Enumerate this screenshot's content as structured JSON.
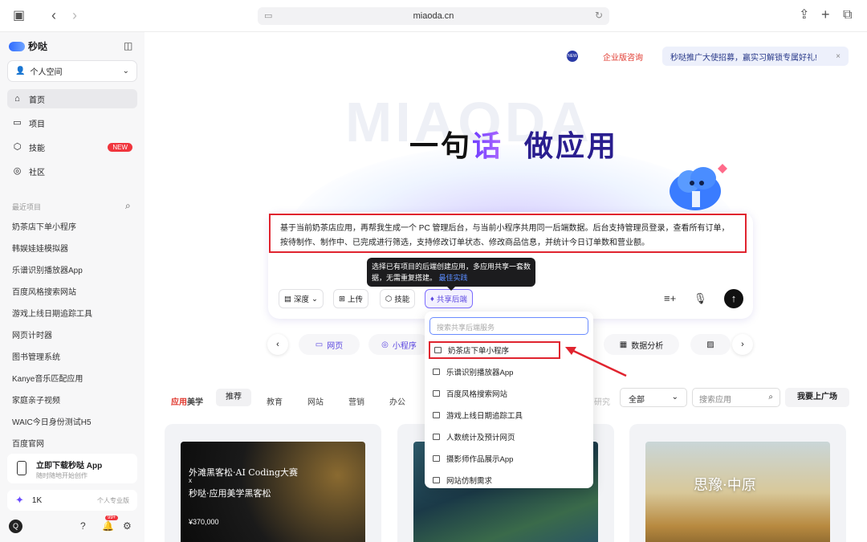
{
  "browser": {
    "url": "miaoda.cn"
  },
  "sidebar": {
    "brand": "秒哒",
    "workspace": "个人空间",
    "nav": [
      {
        "label": "首页",
        "icon": "home-icon"
      },
      {
        "label": "项目",
        "icon": "folder-icon"
      },
      {
        "label": "技能",
        "icon": "skill-icon",
        "badge": "NEW"
      },
      {
        "label": "社区",
        "icon": "community-icon"
      }
    ],
    "recent_title": "最近项目",
    "recent": [
      "奶茶店下单小程序",
      "韩娱娃娃模拟器",
      "乐谱识别播放器App",
      "百度风格搜索网站",
      "游戏上线日期追踪工具",
      "网页计时器",
      "图书管理系统",
      "Kanye音乐匹配应用",
      "家庭亲子视频",
      "WAIC今日身份测试H5",
      "百度官网"
    ],
    "download": {
      "title": "立即下载秒哒 App",
      "subtitle": "随时随地开始创作"
    },
    "pro": {
      "count": "1K",
      "label": "个人专业版"
    },
    "avatar": "Q",
    "notif_badge": "99+"
  },
  "header": {
    "new_badge": "NEW",
    "enterprise": "企业版咨询",
    "promo": "秒哒推广大使招募，赢实习解锁专属好礼!"
  },
  "hero": {
    "watermark": "MIAODA",
    "part1": "一句",
    "part2": "话",
    "part3": "做应用"
  },
  "prompt": {
    "text": "基于当前奶茶店应用，再帮我生成一个 PC 管理后台，与当前小程序共用同一后端数据。后台支持管理员登录，查看所有订单，按待制作、制作中、已完成进行筛选，支持修改订单状态、修改商品信息，并统计今日订单数和营业额。",
    "tools": {
      "depth": "深度",
      "upload": "上传",
      "skill": "技能",
      "shared": "共享后端"
    }
  },
  "tooltip": {
    "text": "选择已有项目的后端创建应用，多应用共享一套数据，无需重复搭建。",
    "link": "最佳实践"
  },
  "dropdown": {
    "placeholder": "搜索共享后端服务",
    "items": [
      "奶茶店下单小程序",
      "乐谱识别播放器App",
      "百度风格搜索网站",
      "游戏上线日期追踪工具",
      "人数统计及预计网页",
      "摄影师作品展示App",
      "网站仿制需求"
    ]
  },
  "chips": {
    "web": "网页",
    "mini": "小程序",
    "data": "数据分析"
  },
  "gallery": {
    "label1": "应用",
    "label2": "美学",
    "tabs": [
      "推荐",
      "教育",
      "网站",
      "营销",
      "办公"
    ],
    "hidden": "研究",
    "filter": "全部",
    "search_placeholder": "搜索应用",
    "plaza": "我要上广场",
    "card1": {
      "title": "外滩黑客松·AI Coding大赛",
      "x": "x",
      "sub": "秒哒·应用美学黑客松",
      "prize": "¥370,000"
    },
    "card3": {
      "title": "思豫·中原"
    }
  }
}
